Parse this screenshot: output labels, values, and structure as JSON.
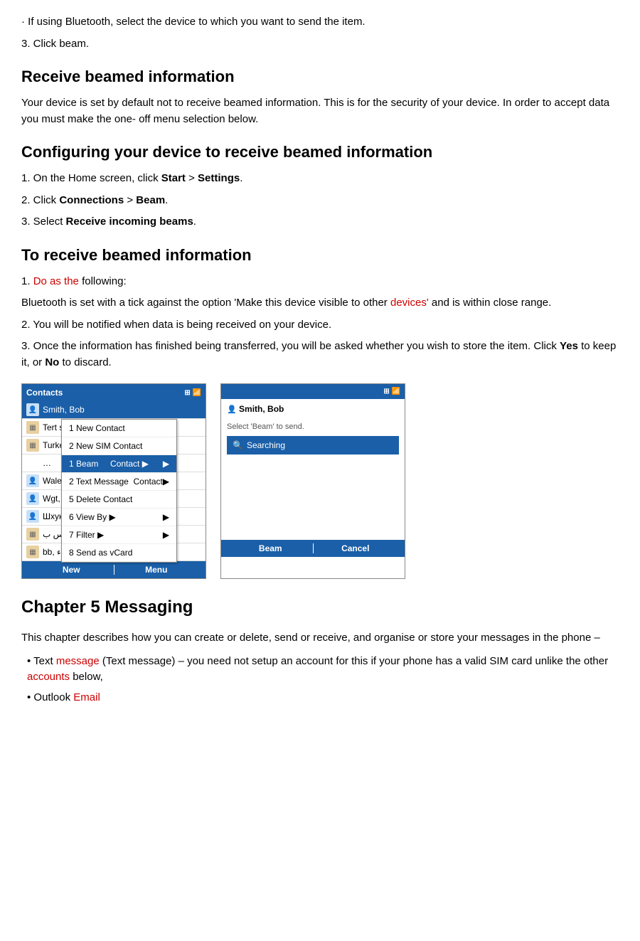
{
  "page": {
    "bullet1": "· If using Bluetooth, select the device to which you want to send the item.",
    "step3_click_beam": "3. Click beam.",
    "section_receive": {
      "heading": "Receive beamed information",
      "body": "Your device is set by default not to receive beamed information. This is for the security of your device. In order to accept data you must make the one- off menu selection below."
    },
    "section_configuring": {
      "heading": "Configuring your device to receive beamed information",
      "step1": "1. On the Home screen, click ",
      "step1_bold1": "Start",
      "step1_mid": " > ",
      "step1_bold2": "Settings",
      "step1_end": ".",
      "step2": "2. Click ",
      "step2_bold1": "Connections",
      "step2_mid": " > ",
      "step2_bold2": "Beam",
      "step2_end": ".",
      "step3": "3. Select ",
      "step3_bold": "Receive incoming beams",
      "step3_end": "."
    },
    "section_to_receive": {
      "heading": "To receive beamed information",
      "step1_pre": "1. ",
      "step1_red": "Do as the",
      "step1_post": " following:",
      "step1_body": "Bluetooth is set with a tick against the option 'Make this device visible to other ",
      "step1_red2": "devices'",
      "step1_body2": " and is within close range.",
      "step2": "2. You will be notified when data is being received on your device.",
      "step3": "3. Once the information has finished being transferred, you will be asked whether you wish to store the item. Click ",
      "step3_bold1": "Yes",
      "step3_mid": " to keep it, or ",
      "step3_bold2": "No",
      "step3_end": " to discard."
    },
    "left_screen": {
      "title": "Contacts",
      "icons": "📶",
      "contacts": [
        {
          "icon": "person",
          "name": "Smith, Bob"
        },
        {
          "icon": "sim",
          "name": "Tert si…"
        },
        {
          "icon": "sim",
          "name": "Turké…"
        },
        {
          "icon": "person",
          "name": "Waleeq"
        },
        {
          "icon": "person",
          "name": "Wgt, A"
        },
        {
          "icon": "person",
          "name": "Шхук"
        },
        {
          "icon": "sim",
          "name": "ش ط س ب"
        },
        {
          "icon": "sim",
          "name": "bb, ر ء"
        }
      ],
      "menu_items": [
        {
          "num": "1",
          "label": "New Contact"
        },
        {
          "num": "2",
          "label": "New SIM Contact"
        },
        {
          "num": "1",
          "label": "Beam",
          "type": "Beam",
          "selected": true,
          "has_arrow": true
        },
        {
          "num": "2",
          "label": "Text Message",
          "type": "Contact"
        },
        {
          "num": "5",
          "label": "Delete Contact"
        },
        {
          "num": "6",
          "label": "View By",
          "has_arrow": true
        },
        {
          "num": "7",
          "label": "Filter",
          "has_arrow": true
        },
        {
          "num": "8",
          "label": "Send as vCard"
        }
      ],
      "bottom_left": "New",
      "bottom_divider": "|",
      "bottom_right": "Menu"
    },
    "right_screen": {
      "title": "",
      "contact_name": "Smith, Bob",
      "subtitle": "Select 'Beam' to send.",
      "searching": "Searching",
      "bottom_left": "Beam",
      "bottom_right": "Cancel"
    },
    "chapter": {
      "title": "Chapter 5 Messaging",
      "intro": "This chapter describes how you can create or delete, send or receive, and organise or store your messages in the phone –",
      "bullet1_pre": "• Text ",
      "bullet1_red": "message",
      "bullet1_post": " (Text message) – you need not setup an account for this if your phone has a valid SIM card unlike the other ",
      "bullet1_red2": "accounts",
      "bullet1_end": " below,",
      "bullet2_pre": "• Outlook ",
      "bullet2_red": "Email"
    }
  }
}
